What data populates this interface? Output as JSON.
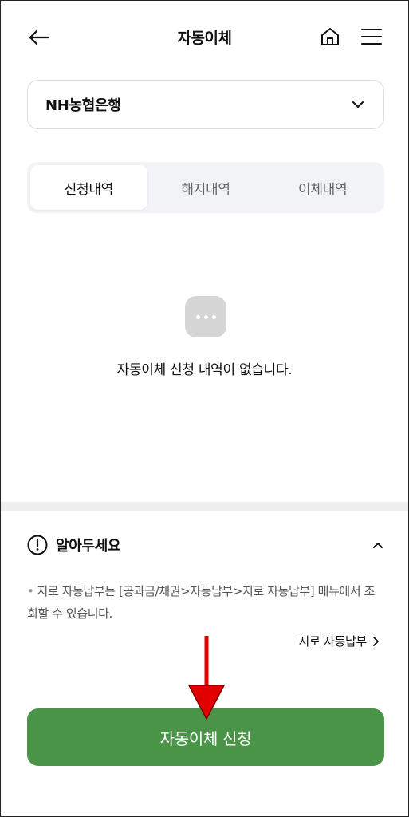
{
  "header": {
    "title": "자동이체",
    "back_icon": "arrow-left-icon",
    "home_icon": "home-icon",
    "menu_icon": "hamburger-menu-icon"
  },
  "bank_select": {
    "value": "NH농협은행",
    "icon": "chevron-down-icon"
  },
  "tabs": [
    {
      "label": "신청내역",
      "active": true
    },
    {
      "label": "해지내역",
      "active": false
    },
    {
      "label": "이체내역",
      "active": false
    }
  ],
  "empty_state": {
    "icon": "more-dots-icon",
    "message": "자동이체 신청 내역이 없습니다."
  },
  "notice": {
    "title": "알아두세요",
    "icon": "exclamation-circle-icon",
    "toggle_icon": "chevron-up-icon",
    "bullet": "•",
    "text": "지로 자동납부는 [공과금/채권>자동납부>지로 자동납부] 메뉴에서 조회할 수 있습니다.",
    "link_label": "지로 자동납부",
    "link_icon": "chevron-right-icon"
  },
  "cta": {
    "label": "자동이체 신청"
  },
  "colors": {
    "primary_green": "#4a9448",
    "tab_bg": "#f1f3f6",
    "annotation_red": "#e00000"
  }
}
